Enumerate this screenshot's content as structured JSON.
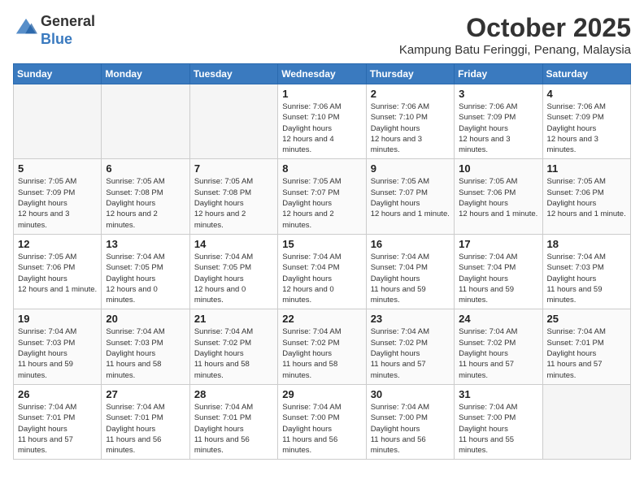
{
  "header": {
    "logo_general": "General",
    "logo_blue": "Blue",
    "month_title": "October 2025",
    "location": "Kampung Batu Feringgi, Penang, Malaysia"
  },
  "weekdays": [
    "Sunday",
    "Monday",
    "Tuesday",
    "Wednesday",
    "Thursday",
    "Friday",
    "Saturday"
  ],
  "weeks": [
    [
      {
        "day": "",
        "empty": true
      },
      {
        "day": "",
        "empty": true
      },
      {
        "day": "",
        "empty": true
      },
      {
        "day": "1",
        "sunrise": "7:06 AM",
        "sunset": "7:10 PM",
        "daylight": "12 hours and 4 minutes."
      },
      {
        "day": "2",
        "sunrise": "7:06 AM",
        "sunset": "7:10 PM",
        "daylight": "12 hours and 3 minutes."
      },
      {
        "day": "3",
        "sunrise": "7:06 AM",
        "sunset": "7:09 PM",
        "daylight": "12 hours and 3 minutes."
      },
      {
        "day": "4",
        "sunrise": "7:06 AM",
        "sunset": "7:09 PM",
        "daylight": "12 hours and 3 minutes."
      }
    ],
    [
      {
        "day": "5",
        "sunrise": "7:05 AM",
        "sunset": "7:09 PM",
        "daylight": "12 hours and 3 minutes."
      },
      {
        "day": "6",
        "sunrise": "7:05 AM",
        "sunset": "7:08 PM",
        "daylight": "12 hours and 2 minutes."
      },
      {
        "day": "7",
        "sunrise": "7:05 AM",
        "sunset": "7:08 PM",
        "daylight": "12 hours and 2 minutes."
      },
      {
        "day": "8",
        "sunrise": "7:05 AM",
        "sunset": "7:07 PM",
        "daylight": "12 hours and 2 minutes."
      },
      {
        "day": "9",
        "sunrise": "7:05 AM",
        "sunset": "7:07 PM",
        "daylight": "12 hours and 1 minute."
      },
      {
        "day": "10",
        "sunrise": "7:05 AM",
        "sunset": "7:06 PM",
        "daylight": "12 hours and 1 minute."
      },
      {
        "day": "11",
        "sunrise": "7:05 AM",
        "sunset": "7:06 PM",
        "daylight": "12 hours and 1 minute."
      }
    ],
    [
      {
        "day": "12",
        "sunrise": "7:05 AM",
        "sunset": "7:06 PM",
        "daylight": "12 hours and 1 minute."
      },
      {
        "day": "13",
        "sunrise": "7:04 AM",
        "sunset": "7:05 PM",
        "daylight": "12 hours and 0 minutes."
      },
      {
        "day": "14",
        "sunrise": "7:04 AM",
        "sunset": "7:05 PM",
        "daylight": "12 hours and 0 minutes."
      },
      {
        "day": "15",
        "sunrise": "7:04 AM",
        "sunset": "7:04 PM",
        "daylight": "12 hours and 0 minutes."
      },
      {
        "day": "16",
        "sunrise": "7:04 AM",
        "sunset": "7:04 PM",
        "daylight": "11 hours and 59 minutes."
      },
      {
        "day": "17",
        "sunrise": "7:04 AM",
        "sunset": "7:04 PM",
        "daylight": "11 hours and 59 minutes."
      },
      {
        "day": "18",
        "sunrise": "7:04 AM",
        "sunset": "7:03 PM",
        "daylight": "11 hours and 59 minutes."
      }
    ],
    [
      {
        "day": "19",
        "sunrise": "7:04 AM",
        "sunset": "7:03 PM",
        "daylight": "11 hours and 59 minutes."
      },
      {
        "day": "20",
        "sunrise": "7:04 AM",
        "sunset": "7:03 PM",
        "daylight": "11 hours and 58 minutes."
      },
      {
        "day": "21",
        "sunrise": "7:04 AM",
        "sunset": "7:02 PM",
        "daylight": "11 hours and 58 minutes."
      },
      {
        "day": "22",
        "sunrise": "7:04 AM",
        "sunset": "7:02 PM",
        "daylight": "11 hours and 58 minutes."
      },
      {
        "day": "23",
        "sunrise": "7:04 AM",
        "sunset": "7:02 PM",
        "daylight": "11 hours and 57 minutes."
      },
      {
        "day": "24",
        "sunrise": "7:04 AM",
        "sunset": "7:02 PM",
        "daylight": "11 hours and 57 minutes."
      },
      {
        "day": "25",
        "sunrise": "7:04 AM",
        "sunset": "7:01 PM",
        "daylight": "11 hours and 57 minutes."
      }
    ],
    [
      {
        "day": "26",
        "sunrise": "7:04 AM",
        "sunset": "7:01 PM",
        "daylight": "11 hours and 57 minutes."
      },
      {
        "day": "27",
        "sunrise": "7:04 AM",
        "sunset": "7:01 PM",
        "daylight": "11 hours and 56 minutes."
      },
      {
        "day": "28",
        "sunrise": "7:04 AM",
        "sunset": "7:01 PM",
        "daylight": "11 hours and 56 minutes."
      },
      {
        "day": "29",
        "sunrise": "7:04 AM",
        "sunset": "7:00 PM",
        "daylight": "11 hours and 56 minutes."
      },
      {
        "day": "30",
        "sunrise": "7:04 AM",
        "sunset": "7:00 PM",
        "daylight": "11 hours and 56 minutes."
      },
      {
        "day": "31",
        "sunrise": "7:04 AM",
        "sunset": "7:00 PM",
        "daylight": "11 hours and 55 minutes."
      },
      {
        "day": "",
        "empty": true
      }
    ]
  ],
  "labels": {
    "sunrise": "Sunrise:",
    "sunset": "Sunset:",
    "daylight": "Daylight hours"
  }
}
